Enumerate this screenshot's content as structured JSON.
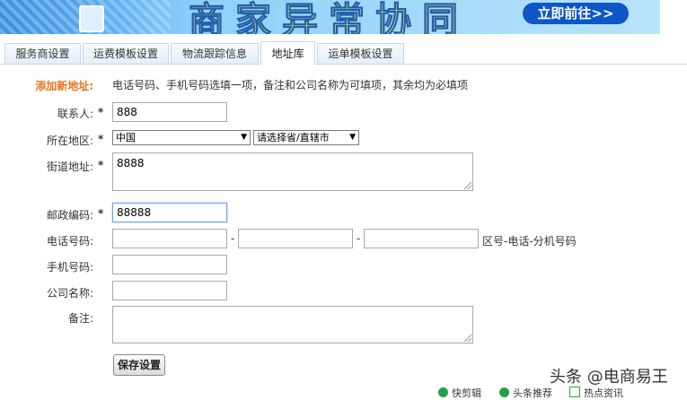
{
  "banner": {
    "slogan": "商家异常协同",
    "cta": "立即前往>>"
  },
  "tabs": [
    {
      "label": "服务商设置"
    },
    {
      "label": "运费模板设置"
    },
    {
      "label": "物流跟踪信息"
    },
    {
      "label": "地址库"
    },
    {
      "label": "运单模板设置"
    }
  ],
  "form": {
    "section_label": "添加新地址:",
    "hint": "电话号码、手机号码选填一项，备注和公司名称为可填项，其余均为必填项",
    "required_mark": "*",
    "contact": {
      "label": "联系人:",
      "value": "888"
    },
    "region": {
      "label": "所在地区:",
      "country": "中国",
      "province": "请选择省/直辖市"
    },
    "street": {
      "label": "街道地址:",
      "value": "8888"
    },
    "postcode": {
      "label": "邮政编码:",
      "value": "88888"
    },
    "phone": {
      "label": "电话号码:",
      "separator": "-",
      "hint": "区号-电话-分机号码"
    },
    "mobile": {
      "label": "手机号码:"
    },
    "company": {
      "label": "公司名称:"
    },
    "remark": {
      "label": "备注:"
    },
    "save_button": "保存设置"
  },
  "watermark": "头条 @电商易王",
  "bottom_bar": {
    "item1": "快剪辑",
    "item2": "头条推荐",
    "item3": "热点资讯"
  }
}
